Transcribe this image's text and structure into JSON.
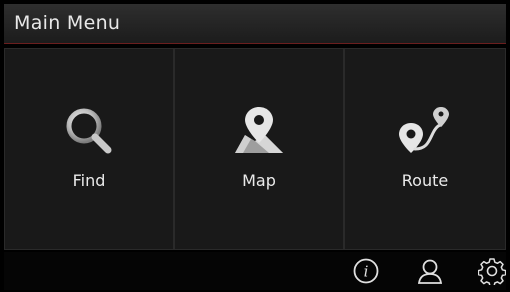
{
  "header": {
    "title": "Main Menu"
  },
  "tiles": [
    {
      "label": "Find",
      "icon": "search-icon"
    },
    {
      "label": "Map",
      "icon": "map-pin-icon"
    },
    {
      "label": "Route",
      "icon": "route-icon"
    }
  ],
  "footer": {
    "icons": [
      "info-icon",
      "user-icon",
      "gear-icon"
    ]
  },
  "colors": {
    "background": "#000000",
    "tile": "#191919",
    "accent_line": "#6b1e1e",
    "text": "#eaeaea"
  }
}
